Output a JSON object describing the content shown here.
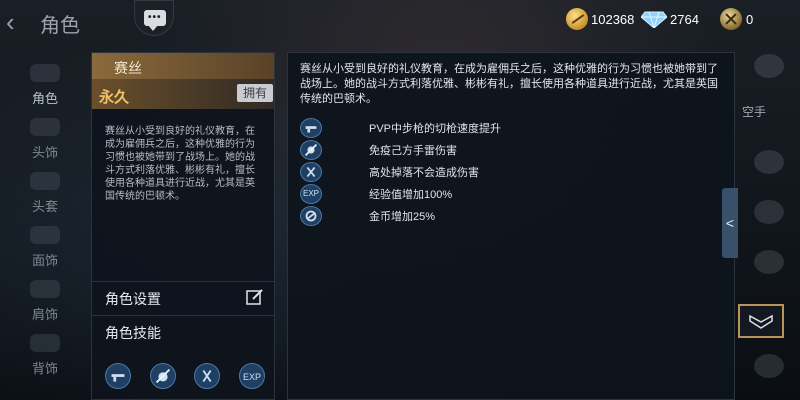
{
  "header": {
    "back_glyph": "‹",
    "title": "角色",
    "chat_icon": "chat-bubble-icon",
    "currency": {
      "gold": "102368",
      "diamond": "2764",
      "ammo": "0"
    }
  },
  "left_nav": {
    "items": [
      {
        "label": "角色",
        "active": true
      },
      {
        "label": "头饰",
        "active": false
      },
      {
        "label": "头套",
        "active": false
      },
      {
        "label": "面饰",
        "active": false
      },
      {
        "label": "肩饰",
        "active": false
      },
      {
        "label": "背饰",
        "active": false
      }
    ]
  },
  "card": {
    "name": "赛丝",
    "permanence": "永久",
    "owned_badge": "拥有",
    "description": "赛丝从小受到良好的礼仪教育，在成为雇佣兵之后，这种优雅的行为习惯也被她带到了战场上。她的战斗方式利落优雅、彬彬有礼，擅长使用各种道具进行近战，尤其是英国传统的巴顿术。",
    "settings_label": "角色设置",
    "skills_label": "角色技能",
    "skill_icons": [
      "gun-skill-icon",
      "mine-immune-icon",
      "fall-immune-icon",
      "exp-boost-icon"
    ],
    "exp_glyph": "EXP"
  },
  "detail": {
    "description": "赛丝从小受到良好的礼仪教育，在成为雇佣兵之后，这种优雅的行为习惯也被她带到了战场上。她的战斗方式利落优雅、彬彬有礼，擅长使用各种道具进行近战，尤其是英国传统的巴顿术。",
    "skills": [
      {
        "icon": "gun-skill-icon",
        "text": "PVP中步枪的切枪速度提升"
      },
      {
        "icon": "mine-immune-icon",
        "text": "免疫己方手雷伤害"
      },
      {
        "icon": "fall-immune-icon",
        "text": "高处掉落不会造成伤害"
      },
      {
        "icon": "exp-boost-icon",
        "text": "经验值增加100%"
      },
      {
        "icon": "gold-boost-icon",
        "text": "金币增加25%"
      }
    ],
    "collapse_glyph": "<"
  },
  "right_nav": {
    "label": "空手"
  },
  "colors": {
    "accent_gold": "#f2c26b",
    "header_brown": "#8a6a3c",
    "skill_blue": "#1f3f63"
  }
}
